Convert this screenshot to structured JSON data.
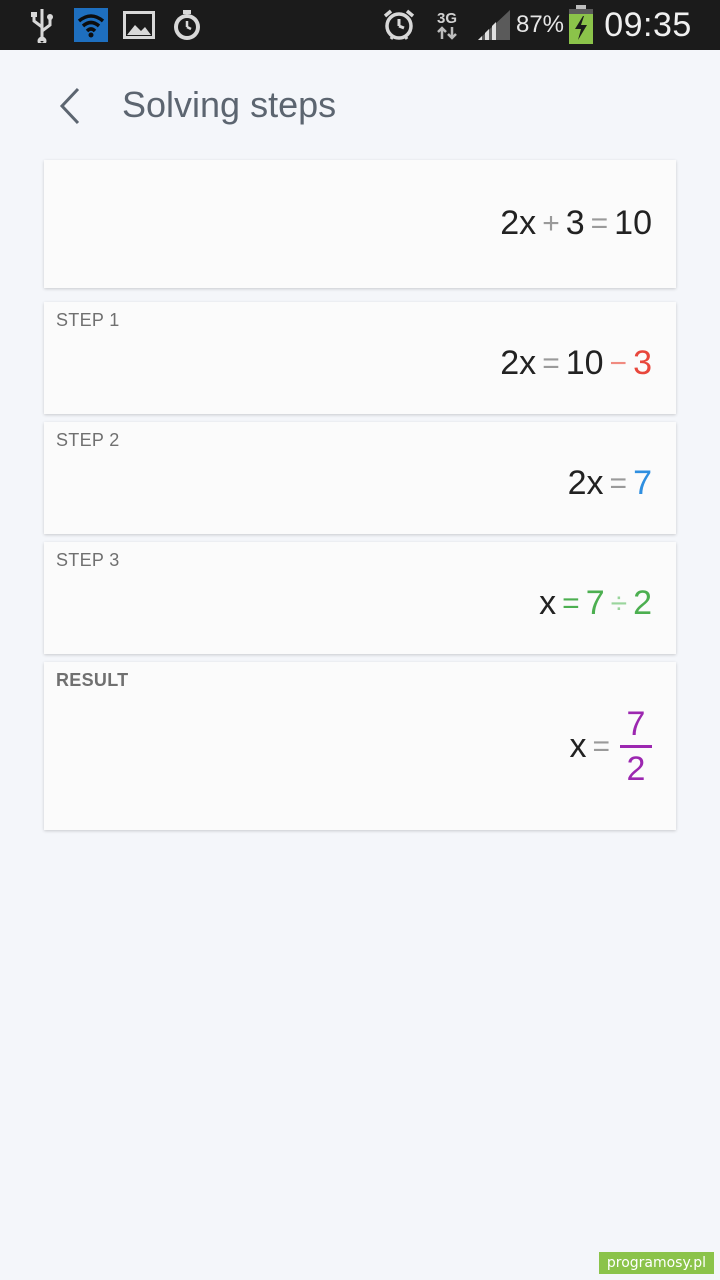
{
  "status_bar": {
    "network": "3G",
    "battery": "87%",
    "time": "09:35",
    "icons": [
      "usb-icon",
      "wifi-icon",
      "gallery-icon",
      "stopwatch-icon",
      "alarm-icon",
      "signal-icon",
      "battery-charging-icon"
    ]
  },
  "header": {
    "title": "Solving steps"
  },
  "problem": {
    "lhs_coef": "2x",
    "op1": "+",
    "term": "3",
    "eq": "=",
    "rhs": "10"
  },
  "steps": [
    {
      "label": "STEP 1",
      "lhs": "2x",
      "eq": "=",
      "a": "10",
      "op": "−",
      "b": "3"
    },
    {
      "label": "STEP 2",
      "lhs": "2x",
      "eq": "=",
      "value": "7"
    },
    {
      "label": "STEP 3",
      "lhs": "x",
      "eq": "=",
      "a": "7",
      "op": "÷",
      "b": "2"
    }
  ],
  "result": {
    "label": "RESULT",
    "lhs": "x",
    "eq": "=",
    "numerator": "7",
    "denominator": "2"
  },
  "watermark": "programosy.pl",
  "colors": {
    "red": "#e8473c",
    "blue": "#2f8fe0",
    "green": "#4caf50",
    "purple": "#9c27b0"
  }
}
